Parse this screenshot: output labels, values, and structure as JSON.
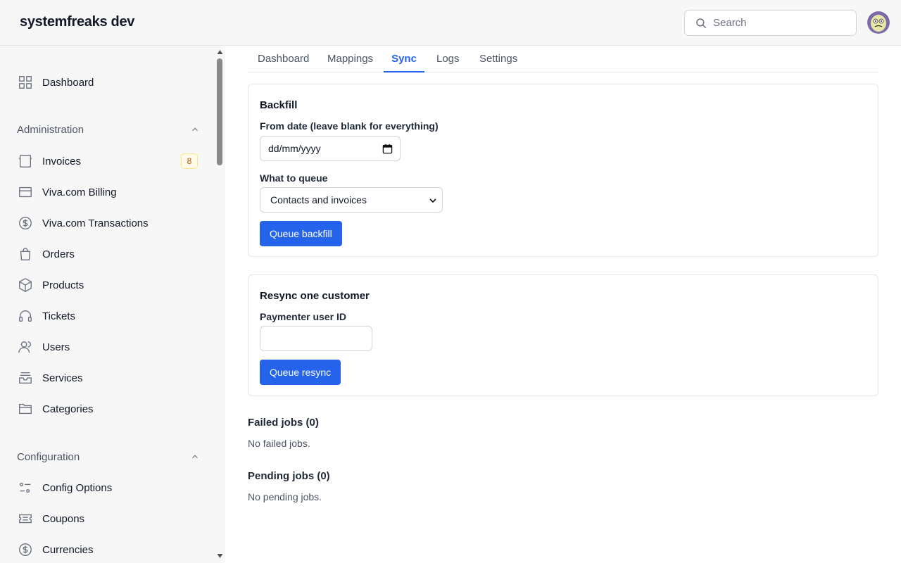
{
  "header": {
    "brand": "systemfreaks dev",
    "search_placeholder": "Search"
  },
  "sidebar": {
    "dashboard": {
      "label": "Dashboard",
      "icon": "grid-icon"
    },
    "administration": {
      "label": "Administration",
      "items": [
        {
          "label": "Invoices",
          "icon": "invoice-icon",
          "badge": "8"
        },
        {
          "label": "Viva.com Billing",
          "icon": "credit-card-icon"
        },
        {
          "label": "Viva.com Transactions",
          "icon": "dollar-circle-icon"
        },
        {
          "label": "Orders",
          "icon": "shopping-bag-icon"
        },
        {
          "label": "Products",
          "icon": "cube-icon"
        },
        {
          "label": "Tickets",
          "icon": "headphones-icon"
        },
        {
          "label": "Users",
          "icon": "users-icon"
        },
        {
          "label": "Services",
          "icon": "inbox-stack-icon"
        },
        {
          "label": "Categories",
          "icon": "folder-icon"
        }
      ]
    },
    "configuration": {
      "label": "Configuration",
      "items": [
        {
          "label": "Config Options",
          "icon": "sliders-icon"
        },
        {
          "label": "Coupons",
          "icon": "ticket-icon"
        },
        {
          "label": "Currencies",
          "icon": "dollar-circle-icon"
        }
      ]
    }
  },
  "tabs": [
    {
      "label": "Dashboard",
      "active": false
    },
    {
      "label": "Mappings",
      "active": false
    },
    {
      "label": "Sync",
      "active": true
    },
    {
      "label": "Logs",
      "active": false
    },
    {
      "label": "Settings",
      "active": false
    }
  ],
  "backfill": {
    "title": "Backfill",
    "from_date_label": "From date (leave blank for everything)",
    "from_date_placeholder": "dd/mm/yyyy",
    "queue_label": "What to queue",
    "queue_value": "Contacts and invoices",
    "button": "Queue backfill"
  },
  "resync": {
    "title": "Resync one customer",
    "user_id_label": "Paymenter user ID",
    "user_id_value": "",
    "button": "Queue resync"
  },
  "failed": {
    "title": "Failed jobs (0)",
    "empty": "No failed jobs."
  },
  "pending": {
    "title": "Pending jobs (0)",
    "empty": "No pending jobs."
  },
  "colors": {
    "accent": "#2563eb",
    "badge_text": "#b45309"
  }
}
